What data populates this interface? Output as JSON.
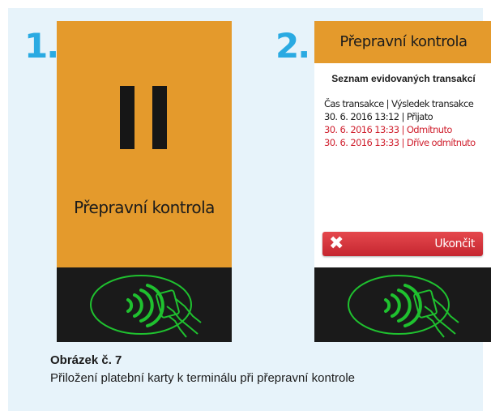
{
  "steps": {
    "one": "1.",
    "two": "2."
  },
  "terminal1": {
    "title": "Přepravní kontrola",
    "state_icon": "pause-icon"
  },
  "terminal2": {
    "header": "Přepravní kontrola",
    "list_title": "Seznam evidovaných transakcí",
    "column_header": "Čas transakce | Výsledek transakce",
    "transactions": [
      {
        "text": "30. 6. 2016 13:12 | Přijato",
        "status": "ok"
      },
      {
        "text": "30. 6. 2016 13:33 | Odmítnuto",
        "status": "rejected"
      },
      {
        "text": "30. 6. 2016 13:33 | Dříve odmítnuto",
        "status": "rejected"
      }
    ],
    "end_button": {
      "label": "Ukončit",
      "icon": "close-icon"
    }
  },
  "reader_icon": "contactless-card-icon",
  "caption": {
    "title": "Obrázek č. 7",
    "text": "Přiložení platební karty k terminálu při přepravní kontrole"
  },
  "colors": {
    "panel_background": "#e7f3fa",
    "step_number": "#2aaae2",
    "screen_orange": "#e49a2c",
    "reader_dark": "#1a1a1a",
    "contactless_green": "#1fc12f",
    "rejected_red": "#d0212f",
    "button_red": "#d5343b"
  }
}
